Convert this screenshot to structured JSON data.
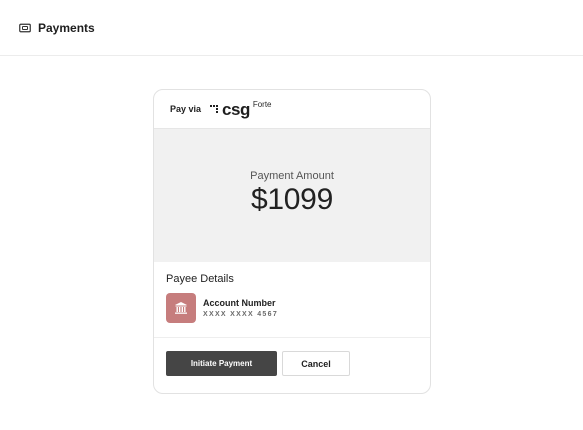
{
  "header": {
    "icon": "payment-card-icon",
    "title": "Payments"
  },
  "card": {
    "pay_via_label": "Pay via",
    "logo": {
      "brand": "csg",
      "suffix": "Forte"
    },
    "amount": {
      "label": "Payment Amount",
      "value": "$1099"
    },
    "payee": {
      "title": "Payee Details",
      "icon": "bank-icon",
      "icon_color": "#c67d7d",
      "account_label": "Account Number",
      "account_number": "XXXX XXXX 4567"
    },
    "actions": {
      "primary_label": "Initiate Payment",
      "secondary_label": "Cancel"
    }
  }
}
